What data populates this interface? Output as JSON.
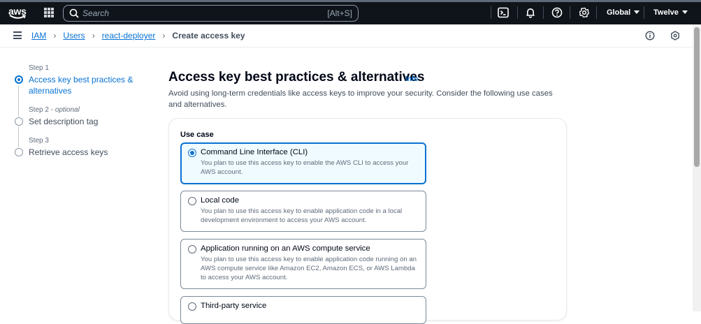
{
  "topbar": {
    "logo_text": "aws",
    "search_placeholder": "Search",
    "search_shortcut": "[Alt+S]",
    "region": "Global",
    "account": "Twelve",
    "icons": [
      "cloudshell-icon",
      "bell-icon",
      "help-icon",
      "gear-icon"
    ]
  },
  "breadcrumbs": {
    "items": [
      "IAM",
      "Users",
      "react-deployer"
    ],
    "current": "Create access key"
  },
  "steps": [
    {
      "num": "Step 1",
      "optional": "",
      "title": "Access key best practices & alternatives",
      "active": true
    },
    {
      "num": "Step 2 - ",
      "optional": "optional",
      "title": "Set description tag",
      "active": false
    },
    {
      "num": "Step 3",
      "optional": "",
      "title": "Retrieve access keys",
      "active": false
    }
  ],
  "page": {
    "title": "Access key best practices & alternatives",
    "info_link": "Info",
    "description": "Avoid using long-term credentials like access keys to improve your security. Consider the following use cases and alternatives."
  },
  "use_case": {
    "label": "Use case",
    "options": [
      {
        "title": "Command Line Interface (CLI)",
        "description": "You plan to use this access key to enable the AWS CLI to access your AWS account.",
        "selected": true
      },
      {
        "title": "Local code",
        "description": "You plan to use this access key to enable application code in a local development environment to access your AWS account.",
        "selected": false
      },
      {
        "title": "Application running on an AWS compute service",
        "description": "You plan to use this access key to enable application code running on an AWS compute service like Amazon EC2, Amazon ECS, or AWS Lambda to access your AWS account.",
        "selected": false
      },
      {
        "title": "Third-party service",
        "description": "",
        "selected": false
      }
    ]
  },
  "colors": {
    "topbar_bg": "#0f141a",
    "link": "#0972d3",
    "selected_tile_bg": "#f0fbff"
  }
}
